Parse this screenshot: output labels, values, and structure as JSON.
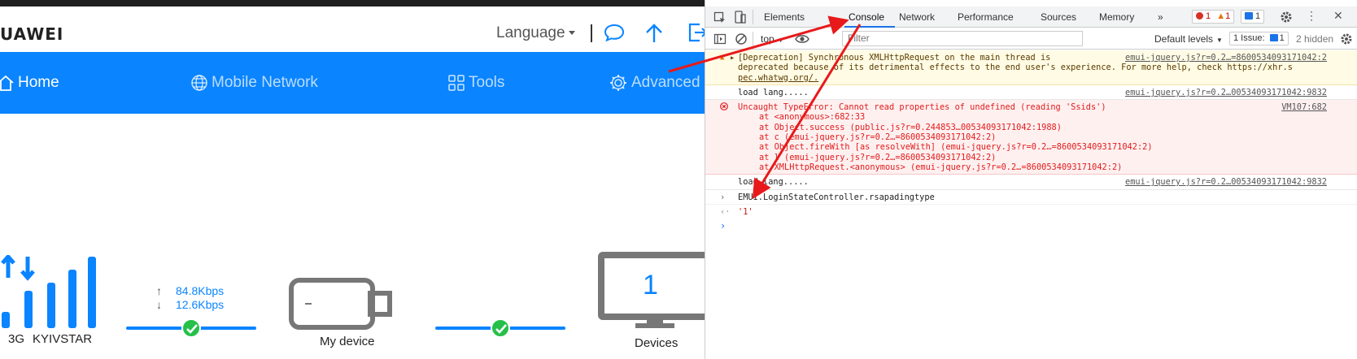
{
  "router": {
    "brand": "UAWEI",
    "language": "Language",
    "nav": [
      {
        "label": "Home"
      },
      {
        "label": "Mobile Network"
      },
      {
        "label": "Tools"
      },
      {
        "label": "Advanced"
      }
    ],
    "network_type": "3G",
    "operator": "KYIVSTAR",
    "upload_speed": "84.8Kbps",
    "download_speed": "12.6Kbps",
    "device_label": "My device",
    "device_count": "1",
    "devices_label": "Devices",
    "colors": {
      "primary": "#0a84ff",
      "success": "#25c04a"
    }
  },
  "devtools": {
    "tabs": [
      "Elements",
      "Console",
      "Network",
      "Performance",
      "Sources",
      "Memory"
    ],
    "active_tab": "Console",
    "more_tabs": "»",
    "error_count": "1",
    "warning_count": "1",
    "message_count": "1",
    "context": "top",
    "filter_placeholder": "Filter",
    "levels": "Default levels",
    "issues": "1 Issue:",
    "issues_count": "1",
    "hidden": "2 hidden",
    "messages": {
      "warn_text_1": "[Deprecation] Synchronous XMLHttpRequest on the main thread is",
      "warn_text_2": "deprecated because of its detrimental effects to the end user's experience. For more help, check https://xhr.s",
      "warn_text_3": "pec.whatwg.org/.",
      "warn_src": "emui-jquery.js?r=0.2…=8600534093171042:2",
      "log1_text": "load lang.....",
      "log1_src": "emui-jquery.js?r=0.2…00534093171042:9832",
      "err_text": "Uncaught TypeError: Cannot read properties of undefined (reading 'Ssids')",
      "err_src": "VM107:682",
      "trace": [
        "at <anonymous>:682:33",
        "at Object.success (public.js?r=0.244853…00534093171042:1988)",
        "at c (emui-jquery.js?r=0.2…=8600534093171042:2)",
        "at Object.fireWith [as resolveWith] (emui-jquery.js?r=0.2…=8600534093171042:2)",
        "at l (emui-jquery.js?r=0.2…=8600534093171042:2)",
        "at XMLHttpRequest.<anonymous> (emui-jquery.js?r=0.2…=8600534093171042:2)"
      ],
      "log2_text": "load lang.....",
      "log2_src": "emui-jquery.js?r=0.2…00534093171042:9832",
      "input": "EMUI.LoginStateController.rsapadingtype",
      "result": "'1'"
    }
  }
}
